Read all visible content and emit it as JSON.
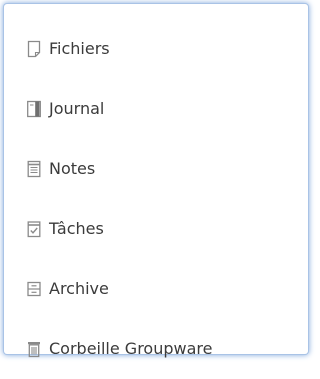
{
  "folder_menu": {
    "items": [
      {
        "label": "Fichiers",
        "icon": "files-icon"
      },
      {
        "label": "Journal",
        "icon": "journal-icon"
      },
      {
        "label": "Notes",
        "icon": "notes-icon"
      },
      {
        "label": "Tâches",
        "icon": "tasks-icon"
      },
      {
        "label": "Archive",
        "icon": "archive-icon"
      },
      {
        "label": "Corbeille Groupware",
        "icon": "trash-icon"
      }
    ]
  },
  "colors": {
    "text": "#3b3b3b",
    "icon": "#8a8a8a",
    "panel_glow": "#7fa7dc"
  }
}
